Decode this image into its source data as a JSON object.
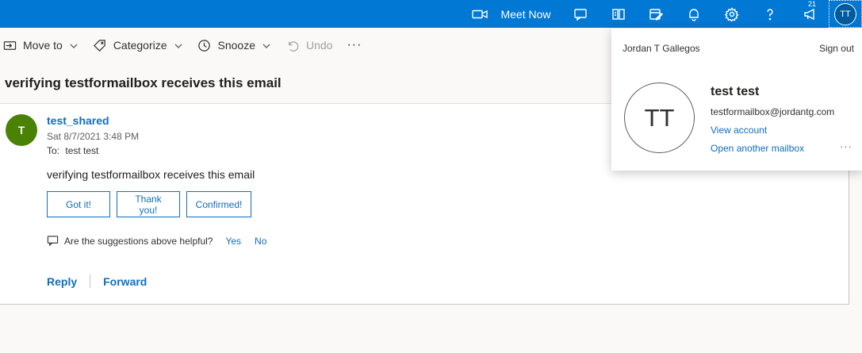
{
  "topbar": {
    "meet_now_label": "Meet Now",
    "notification_count": "21",
    "avatar_initials": "TT",
    "accent_color": "#0078d4"
  },
  "toolbar": {
    "move_to": "Move to",
    "categorize": "Categorize",
    "snooze": "Snooze",
    "undo": "Undo",
    "more": "···"
  },
  "message": {
    "subject": "verifying testformailbox receives this email",
    "sender_initial": "T",
    "sender_name": "test_shared",
    "sent_date": "Sat 8/7/2021 3:48 PM",
    "to_label": "To:",
    "to_value": "test test",
    "body": "verifying testformailbox receives this email",
    "suggested_replies": [
      "Got it!",
      "Thank you!",
      "Confirmed!"
    ],
    "feedback_question": "Are the suggestions above helpful?",
    "feedback_yes": "Yes",
    "feedback_no": "No",
    "reply_label": "Reply",
    "forward_label": "Forward"
  },
  "account_popup": {
    "org_name": "Jordan T Gallegos",
    "sign_out": "Sign out",
    "avatar_initials": "TT",
    "display_name": "test test",
    "email": "testformailbox@jordantg.com",
    "view_account": "View account",
    "open_another_mailbox": "Open another mailbox",
    "more": "···"
  }
}
